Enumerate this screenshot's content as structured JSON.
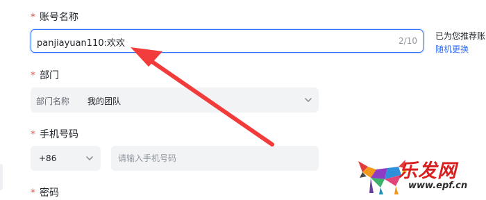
{
  "form": {
    "required_mark": "*",
    "account": {
      "label": "账号名称",
      "value": "panjiayuan110:欢欢",
      "counter": "2/10",
      "hint": "已为您推荐账",
      "random_link": "随机更换"
    },
    "department": {
      "label": "部门",
      "prefix": "部门名称",
      "value": "我的团队"
    },
    "phone": {
      "label": "手机号码",
      "country_code": "+86",
      "placeholder": "请输入手机号码"
    },
    "password": {
      "label": "密码"
    }
  },
  "watermark": {
    "title": "乐发网",
    "url": "www.epf.cn"
  },
  "colors": {
    "accent": "#3370ff",
    "required": "#f54a45",
    "annotation_arrow": "#f23c3c",
    "watermark_red": "#d81e1e"
  }
}
